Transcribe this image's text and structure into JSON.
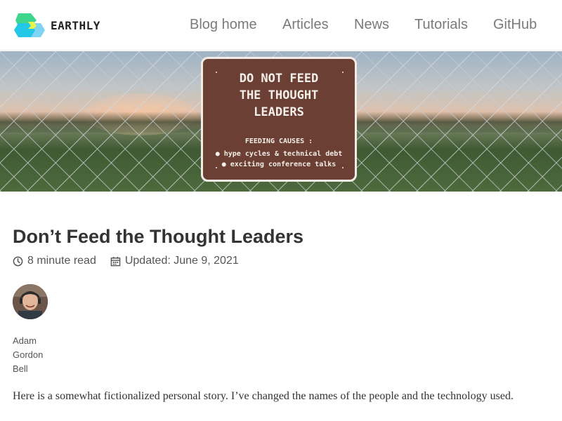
{
  "brand": {
    "name": "EARTHLY"
  },
  "nav": {
    "items": [
      {
        "label": "Blog home"
      },
      {
        "label": "Articles"
      },
      {
        "label": "News"
      },
      {
        "label": "Tutorials"
      },
      {
        "label": "GitHub"
      }
    ]
  },
  "hero": {
    "sign": {
      "headline_lines": [
        "DO NOT FEED",
        "THE THOUGHT",
        "LEADERS"
      ],
      "subheading": "FEEDING CAUSES :",
      "bullets": [
        "● hype cycles & technical debt",
        "● exciting conference talks"
      ]
    }
  },
  "article": {
    "title": "Don’t Feed the Thought Leaders",
    "read_time": "8 minute read",
    "updated": "Updated: June 9, 2021",
    "author": {
      "name_lines": [
        "Adam",
        "Gordon",
        "Bell"
      ]
    },
    "lead": "Here is a somewhat fictionalized personal story. I’ve changed the names of the people and the technology used."
  },
  "colors": {
    "logo_green": "#3dd68c",
    "logo_cyan": "#23c7e8",
    "logo_yellow": "#e8f44a",
    "nav_text": "#7a7a7a",
    "sign_brown": "#6b3f34"
  }
}
